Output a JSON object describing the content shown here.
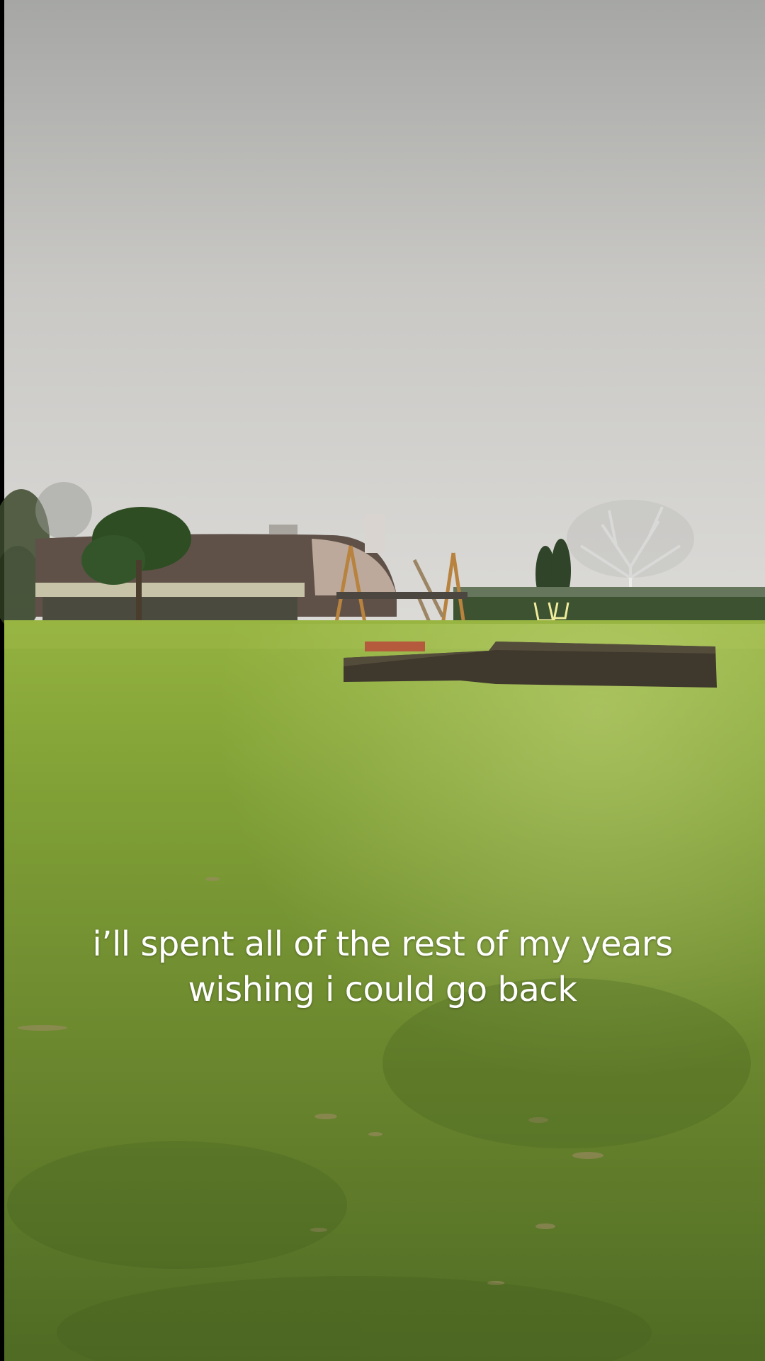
{
  "caption": {
    "line1": "i’ll spent all of the rest of my years",
    "line2": "wishing i could go back"
  },
  "colors": {
    "sky_top": "#a9aaa8",
    "sky_bottom": "#d9d8d5",
    "grass_far": "#8cab3c",
    "grass_near": "#5d7a2a",
    "caption_text": "#ffffff"
  }
}
